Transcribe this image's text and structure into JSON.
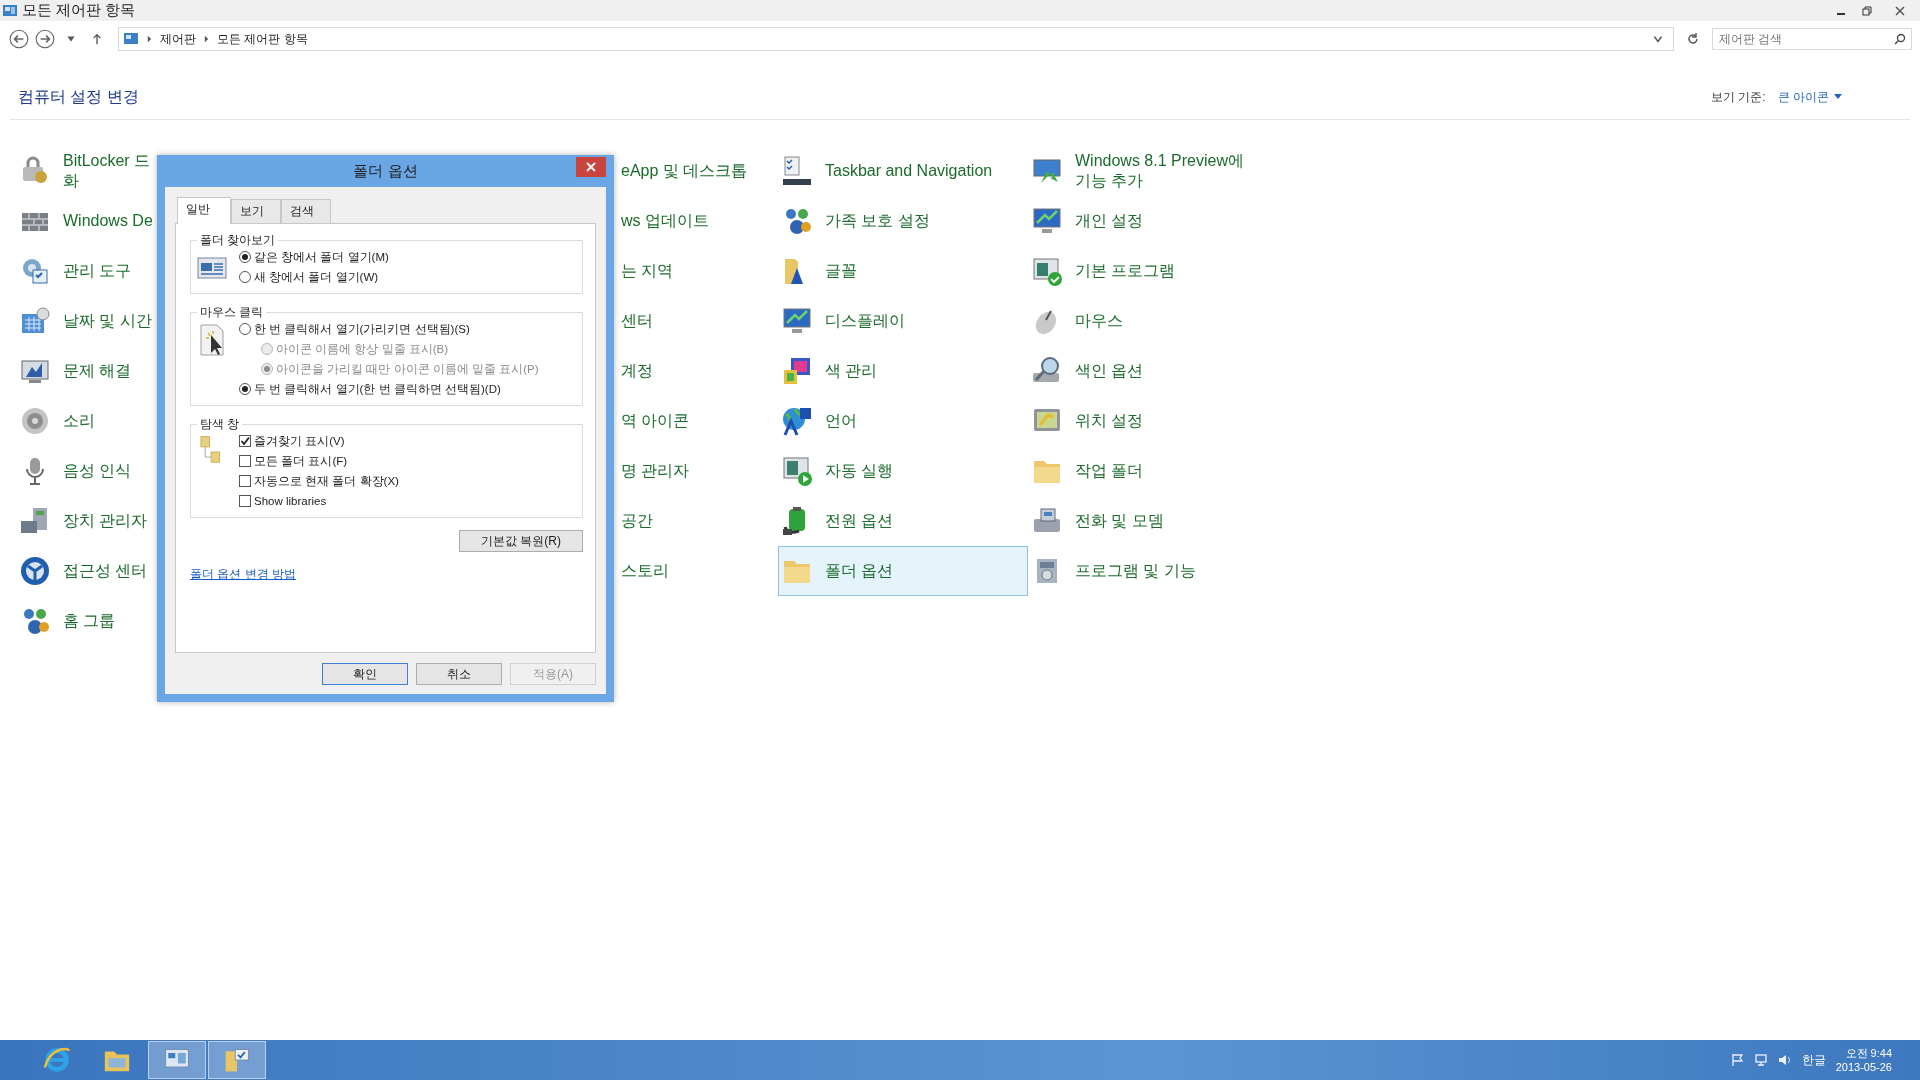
{
  "window": {
    "title": "모든 제어판 항목"
  },
  "address_bar": {
    "crumbs": [
      "제어판",
      "모든 제어판 항목"
    ]
  },
  "search": {
    "placeholder": "제어판 검색"
  },
  "heading": "컴퓨터 설정 변경",
  "view_by": {
    "label": "보기 기준:",
    "value": "큰 아이콘"
  },
  "columns": [
    {
      "kind": "icons",
      "items": [
        {
          "lines": [
            "BitLocker 드",
            "화"
          ],
          "selected": false
        },
        {
          "lines": [
            "Windows De"
          ],
          "selected": false
        },
        {
          "lines": [
            "관리 도구"
          ],
          "selected": false
        },
        {
          "lines": [
            "날짜 및 시간"
          ],
          "selected": false
        },
        {
          "lines": [
            "문제 해결"
          ],
          "selected": false
        },
        {
          "lines": [
            "소리"
          ],
          "selected": false
        },
        {
          "lines": [
            "음성 인식"
          ],
          "selected": false
        },
        {
          "lines": [
            "장치 관리자"
          ],
          "selected": false
        },
        {
          "lines": [
            "접근성 센터"
          ],
          "selected": false
        },
        {
          "lines": [
            "홈 그룹"
          ],
          "selected": false
        }
      ]
    },
    {
      "kind": "covered",
      "items": [
        {
          "lines": [
            "eApp 및 데스크톱"
          ],
          "selected": false
        },
        {
          "lines": [
            "ws 업데이트"
          ],
          "selected": false
        },
        {
          "lines": [
            "는 지역"
          ],
          "selected": false
        },
        {
          "lines": [
            "센터"
          ],
          "selected": false
        },
        {
          "lines": [
            "계정"
          ],
          "selected": false
        },
        {
          "lines": [
            "역 아이콘"
          ],
          "selected": false
        },
        {
          "lines": [
            "명 관리자"
          ],
          "selected": false
        },
        {
          "lines": [
            "공간"
          ],
          "selected": false
        },
        {
          "lines": [
            "스토리"
          ],
          "selected": false
        }
      ]
    },
    {
      "kind": "icons",
      "items": [
        {
          "lines": [
            "Taskbar and Navigation"
          ],
          "selected": false
        },
        {
          "lines": [
            "가족 보호 설정"
          ],
          "selected": false
        },
        {
          "lines": [
            "글꼴"
          ],
          "selected": false
        },
        {
          "lines": [
            "디스플레이"
          ],
          "selected": false
        },
        {
          "lines": [
            "색 관리"
          ],
          "selected": false
        },
        {
          "lines": [
            "언어"
          ],
          "selected": false
        },
        {
          "lines": [
            "자동 실행"
          ],
          "selected": false
        },
        {
          "lines": [
            "전원 옵션"
          ],
          "selected": false
        },
        {
          "lines": [
            "폴더 옵션"
          ],
          "selected": true
        }
      ]
    },
    {
      "kind": "icons",
      "items": [
        {
          "lines": [
            "Windows 8.1 Preview에",
            "기능 추가"
          ],
          "selected": false
        },
        {
          "lines": [
            "개인 설정"
          ],
          "selected": false
        },
        {
          "lines": [
            "기본 프로그램"
          ],
          "selected": false
        },
        {
          "lines": [
            "마우스"
          ],
          "selected": false
        },
        {
          "lines": [
            "색인 옵션"
          ],
          "selected": false
        },
        {
          "lines": [
            "위치 설정"
          ],
          "selected": false
        },
        {
          "lines": [
            "작업 폴더"
          ],
          "selected": false
        },
        {
          "lines": [
            "전화 및 모뎀"
          ],
          "selected": false
        },
        {
          "lines": [
            "프로그램 및 기능"
          ],
          "selected": false
        }
      ]
    }
  ],
  "dialog": {
    "title": "폴더 옵션",
    "tabs": [
      {
        "label": "일반",
        "selected": true
      },
      {
        "label": "보기",
        "selected": false
      },
      {
        "label": "검색",
        "selected": false
      }
    ],
    "groups": [
      {
        "title": "폴더 찾아보기",
        "kind": "radio",
        "options": [
          {
            "label": "같은 창에서 폴더 열기(M)",
            "selected": true,
            "disabled": false
          },
          {
            "label": "새 창에서 폴더 열기(W)",
            "selected": false,
            "disabled": false
          }
        ]
      },
      {
        "title": "마우스 클릭",
        "kind": "radio",
        "options": [
          {
            "label": "한 번 클릭해서 열기(가리키면 선택됨)(S)",
            "selected": false,
            "disabled": false,
            "children": [
              {
                "label": "아이콘 이름에 항상 밑줄 표시(B)",
                "selected": false,
                "disabled": true
              },
              {
                "label": "아이콘을 가리킬 때만 아이콘 이름에 밑줄 표시(P)",
                "selected": true,
                "disabled": true
              }
            ]
          },
          {
            "label": "두 번 클릭해서 열기(한 번 클릭하면 선택됨)(D)",
            "selected": true,
            "disabled": false
          }
        ]
      },
      {
        "title": "탐색 창",
        "kind": "checkbox",
        "options": [
          {
            "label": "즐겨찾기 표시(V)",
            "checked": true
          },
          {
            "label": "모든 폴더 표시(F)",
            "checked": false
          },
          {
            "label": "자동으로 현재 폴더 확장(X)",
            "checked": false
          },
          {
            "label": "Show libraries",
            "checked": false
          }
        ]
      }
    ],
    "restore_button": "기본값 복원(R)",
    "help_link": "폴더 옵션 변경 방법",
    "buttons": [
      {
        "label": "확인",
        "disabled": false,
        "default": true
      },
      {
        "label": "취소",
        "disabled": false,
        "default": false
      },
      {
        "label": "적용(A)",
        "disabled": true,
        "default": false
      }
    ]
  },
  "taskbar": {
    "apps": [
      {
        "running": false
      },
      {
        "running": false
      },
      {
        "running": true
      },
      {
        "running": true
      }
    ]
  },
  "tray": {
    "language": "한글",
    "time": "오전 9:44",
    "date": "2013-05-26"
  }
}
